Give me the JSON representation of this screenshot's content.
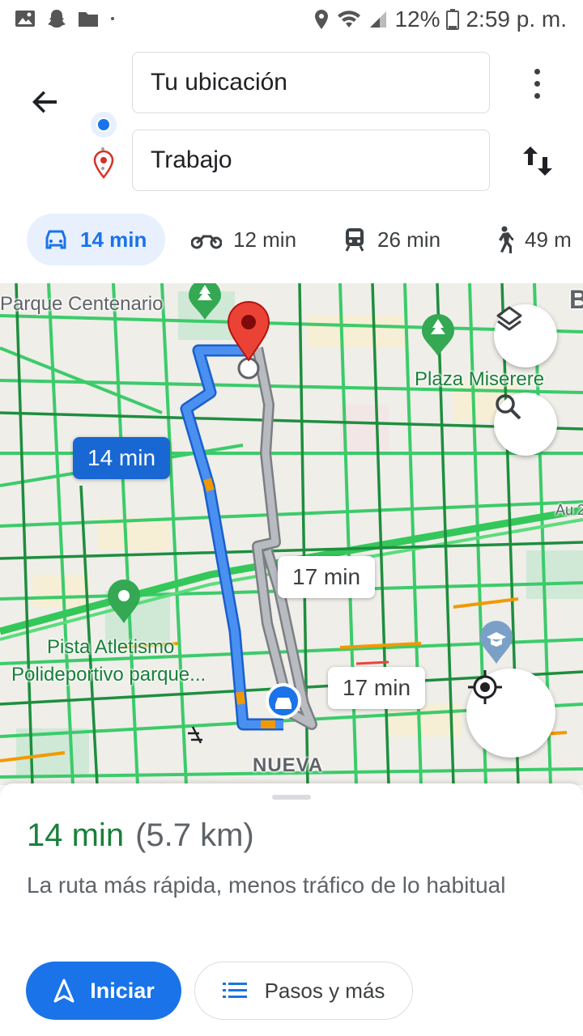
{
  "status_bar": {
    "battery": "12%",
    "time": "2:59 p. m.",
    "icons": [
      "gallery-icon",
      "snapchat-icon",
      "folder-icon",
      "location-icon",
      "wifi-icon",
      "signal-icon",
      "battery-icon"
    ]
  },
  "directions": {
    "origin_value": "Tu ubicación",
    "destination_value": "Trabajo"
  },
  "modes": [
    {
      "name": "car",
      "icon": "car-icon",
      "time": "14 min",
      "selected": true
    },
    {
      "name": "motorcycle",
      "icon": "motorcycle-icon",
      "time": "12 min"
    },
    {
      "name": "transit",
      "icon": "train-icon",
      "time": "26 min"
    },
    {
      "name": "walk",
      "icon": "walk-icon",
      "time": "49 m"
    }
  ],
  "map": {
    "labels": {
      "parque": "Parque Centenario",
      "plaza": "Plaza Miserere",
      "pista": "Pista Atletismo",
      "polideportivo": "Polideportivo parque...",
      "nueva": "NUEVA",
      "au": "Au 2",
      "edge": "B"
    },
    "route_times": {
      "selected": "14 min",
      "alt1": "17 min",
      "alt2": "17 min"
    },
    "colors": {
      "route_selected": "#4285f4",
      "route_alt": "#9aa0a6",
      "traffic_light": "#3ccb6a",
      "traffic_heavy": "#1e8e3e",
      "destination_pin": "#ea4335"
    }
  },
  "sheet": {
    "time": "14 min",
    "distance": "(5.7 km)",
    "description": "La ruta más rápida, menos tráfico de lo habitual",
    "start_label": "Iniciar",
    "steps_label": "Pasos y más"
  }
}
